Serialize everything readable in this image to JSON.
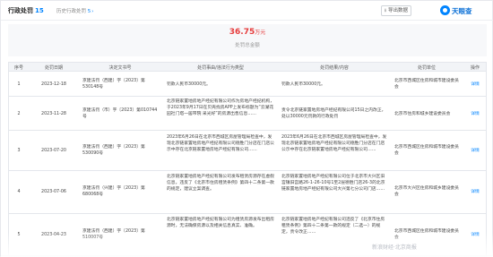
{
  "header": {
    "title": "行政处罚",
    "count": "15",
    "history_label": "历史行政处罚",
    "history_count": "5",
    "export_label": "导出数据",
    "logo_text": "天眼查"
  },
  "summary": {
    "amount": "36.75",
    "unit": "万元",
    "label": "处罚总金额"
  },
  "table": {
    "columns": [
      "序号",
      "处罚日期",
      "决定文书号",
      "处罚事由/违法行为类型",
      "处罚结果/内容",
      "处罚单位",
      "操作"
    ],
    "rows": [
      {
        "index": "1",
        "date": "2023-12-18",
        "doc_no": "京建法罚（西建）字〔2023〕第530148号",
        "reason": "罚款人民币30000元。",
        "result": "罚款人民币30000元。",
        "authority": "北京市西城区住房和城市建设委员会",
        "action": "详情"
      },
      {
        "index": "2",
        "date": "2023-11-28",
        "doc_no": "京建法罚（市）字〔2023〕第010744号",
        "reason": "北京链家置地房地产经纪有限公司作为房地产经纪机构，于2023年9月17日在贝壳找房APP上发布标题为“云湖花园社门塔一居带院 采光好”的房源出售信息……",
        "result": "责令北京链家置地房地产经纪有限公司15日之内改正，处以30000元罚款的行政处罚",
        "authority": "北京市住房和城乡建设委员会",
        "action": "详情"
      },
      {
        "index": "3",
        "date": "2023-07-20",
        "doc_no": "京建法罚（西建）字〔2023〕第530090号",
        "reason": "2023年6月26日在北京市西城区房屋管理局检查中，发现北京链家置地房地产经纪有限公司德胜门分店在门店公示中存在北京链家置地房地产经纪有限公司……",
        "result": "2023年6月26日在北京市西城区房屋管理局检查中，发现北京链家置地房地产经纪有限公司德胜门分店在门店公示中存在北京链家置地房地产经纪有限公司……",
        "authority": "北京市西城区住房和城市建设委员会",
        "action": "详情"
      },
      {
        "index": "4",
        "date": "2023-07-06",
        "doc_no": "京建法罚（兴建）字〔2023〕第680068号",
        "reason": "北京链家置地房地产经纪有限公司发布租赁房源存在虚假信息，违反了《北京市住房租赁条例》第四十二条第一款的规定，建议立案调查。",
        "result": "北京链家置地房地产经纪有限公司位于北京市大兴区旧宫镇旧宫路26-1-26-10号1至2层德胜门店26-3的北京链家置地房地产经纪有限公司大兴第七分公司门店……",
        "authority": "北京市大兴区住房和城乡建设委员会",
        "action": "详情"
      },
      {
        "index": "5",
        "date": "2023-04-23",
        "doc_no": "京建法罚（西建）字〔2023〕第510007号",
        "reason": "北京链家置地房地产经纪有限公司为租赁房源发布出租房源时，无法确保房源以及相关信息真实、准确。",
        "result": "北京链家置地房地产经纪有限公司违反了《北京市住房租赁条例》第四十二条第一款的规定（二选一）的规定，责令改正……",
        "authority": "北京市西城区住房和城市建设委员会",
        "action": "详情"
      }
    ]
  },
  "watermark": "新浪财经·北京商报"
}
